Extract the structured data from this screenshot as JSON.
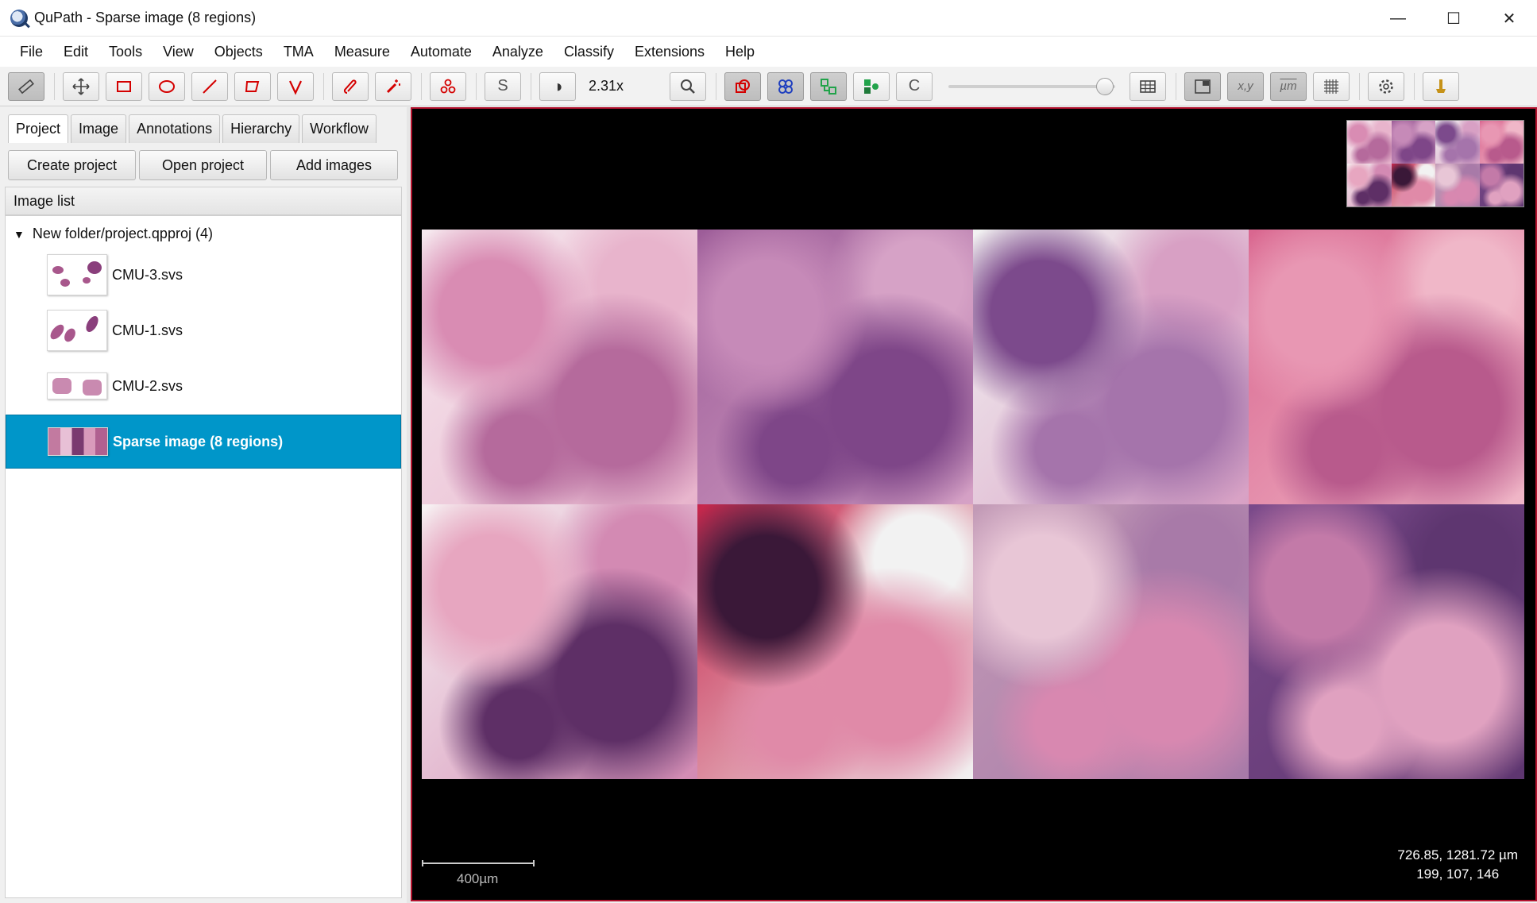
{
  "window": {
    "title": "QuPath - Sparse image (8 regions)",
    "controls": {
      "minimize": "—",
      "maximize": "☐",
      "close": "✕"
    }
  },
  "menu": [
    "File",
    "Edit",
    "Tools",
    "View",
    "Objects",
    "TMA",
    "Measure",
    "Automate",
    "Analyze",
    "Classify",
    "Extensions",
    "Help"
  ],
  "toolbar": {
    "zoom": "2.31x",
    "labels": {
      "selection_mode": "S",
      "brightness": "◑",
      "count": "C",
      "coords": "x,y",
      "units": "µm"
    },
    "icons": [
      "ruler-icon",
      "move-icon",
      "rectangle-icon",
      "ellipse-icon",
      "line-icon",
      "polygon-icon",
      "polyline-icon",
      "brush-icon",
      "wand-icon",
      "points-icon"
    ]
  },
  "left_panel": {
    "tabs": [
      "Project",
      "Image",
      "Annotations",
      "Hierarchy",
      "Workflow"
    ],
    "active_tab": "Project",
    "buttons": {
      "create": "Create project",
      "open": "Open project",
      "add": "Add images"
    },
    "list_header": "Image list",
    "folder": "New folder/project.qpproj (4)",
    "images": [
      {
        "name": "CMU-3.svs",
        "selected": false
      },
      {
        "name": "CMU-1.svs",
        "selected": false
      },
      {
        "name": "CMU-2.svs",
        "selected": false
      },
      {
        "name": "Sparse image (8 regions)",
        "selected": true
      }
    ]
  },
  "viewer": {
    "scale_label": "400µm",
    "cursor_position": "726.85, 1281.72 µm",
    "pixel_value": "199, 107, 146",
    "tiles": [
      {
        "colors": [
          "#f6e9ef",
          "#d98cb3",
          "#b56a9c",
          "#e8b4cc"
        ]
      },
      {
        "colors": [
          "#9c5c98",
          "#c68ab8",
          "#7e4688",
          "#d6a2c6"
        ]
      },
      {
        "colors": [
          "#f2f2f2",
          "#7c4a8c",
          "#a574ab",
          "#d8a0c4"
        ]
      },
      {
        "colors": [
          "#d9668f",
          "#e897b3",
          "#b85a8c",
          "#f0b7c8"
        ]
      },
      {
        "colors": [
          "#f7f2f3",
          "#e7a6c0",
          "#5e2f66",
          "#d38ab3"
        ]
      },
      {
        "colors": [
          "#c5244a",
          "#3a1838",
          "#e08aa8",
          "#f2f2f2"
        ]
      },
      {
        "colors": [
          "#c29ab6",
          "#e8c6d6",
          "#d888b0",
          "#a87aa8"
        ]
      },
      {
        "colors": [
          "#7a4a8a",
          "#c37aa8",
          "#e0a1c0",
          "#5e3670"
        ]
      }
    ]
  },
  "colors": {
    "accent": "#0096c9",
    "viewer_border": "#b3122e",
    "tool_red": "#d40000"
  }
}
